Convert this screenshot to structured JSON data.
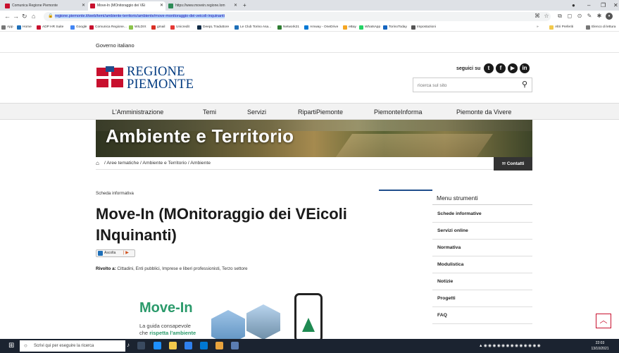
{
  "browser": {
    "tabs": [
      {
        "label": "Comunica Regione Piemonte",
        "active": false
      },
      {
        "label": "Move-In (MOnitoraggio dei VEi",
        "active": true
      },
      {
        "label": "https://www.movein.regione.lom",
        "active": false
      }
    ],
    "new_tab": "+",
    "url": "regione.piemonte.it/web/temi/ambiente-territorio/ambiente/move-monitoraggio-dei-veicoli-inquinanti",
    "bookmarks": [
      "App",
      "Home",
      "ADP HR Suite",
      "Google",
      "Comunica Regione...",
      "WILDIX",
      "gmail",
      "Unicredit",
      "DeepL Traduttore",
      "Le Club Torino Asa...",
      "Network21",
      "Amway - OneDrive",
      "eBay",
      "WhatsApp",
      "TorinoToday",
      "Impostazioni",
      "Altri Preferiti",
      "Elenco di lettura"
    ],
    "bookmark_more": "»"
  },
  "header": {
    "gov_label": "Governo italiano",
    "logo_line1": "REGIONE",
    "logo_line2": "PIEMONTE",
    "social_label": "seguici su",
    "search_placeholder": "ricerca sul sito"
  },
  "main_nav": [
    "L'Amministrazione",
    "Temi",
    "Servizi",
    "RipartiPiemonte",
    "PiemonteInforma",
    "Piemonte da Vivere"
  ],
  "banner_title": "Ambiente e Territorio",
  "breadcrumb": "/ Aree tematiche / Ambiente e Territorio / Ambiente",
  "contatti": "Contatti",
  "article": {
    "type_label": "Scheda informativa",
    "title": "Move-In (MOnitoraggio dei VEicoli INquinanti)",
    "ascolta": "Ascolta",
    "rivolto_label": "Rivolto a:",
    "rivolto_value": " Cittadini, Enti pubblici, Imprese e liberi professionisti, Terzo settore",
    "image_title": "Move-In",
    "image_sub1": "La guida consapevole",
    "image_sub2_pre": "che ",
    "image_sub2_em": "rispetta l'ambiente"
  },
  "menu": {
    "title": "Menu strumenti",
    "items": [
      "Schede informative",
      "Servizi online",
      "Normativa",
      "Modulistica",
      "Notizie",
      "Progetti",
      "FAQ"
    ]
  },
  "taskbar": {
    "search_placeholder": "Scrivi qui per eseguire la ricerca",
    "time": "22:03",
    "date": "13/10/2021"
  },
  "colors": {
    "brand_red": "#c8102e",
    "brand_blue": "#003a80",
    "accent_green": "#2b9a6b"
  }
}
